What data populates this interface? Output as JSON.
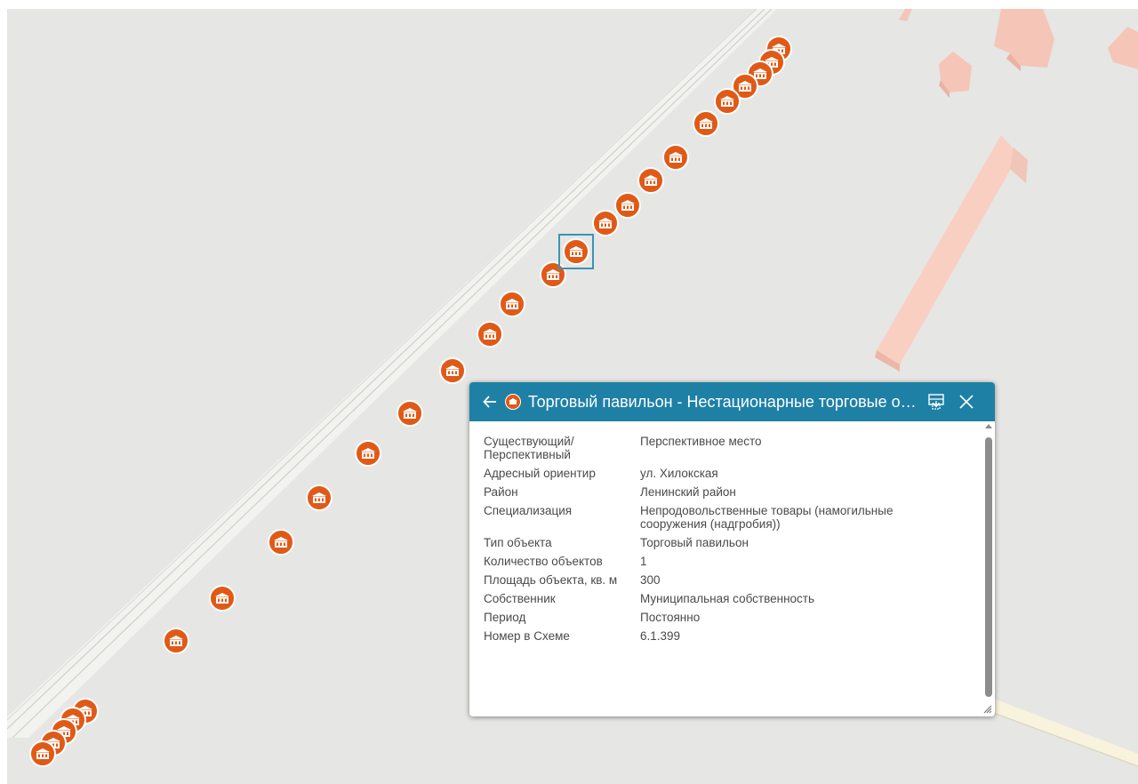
{
  "map": {
    "background": "#e6e6e4",
    "marker_color": "#e05a17",
    "marker_icon": "pavilion-icon",
    "selection_color": "#3b93b8",
    "building_color": "#f5c6b8"
  },
  "popup": {
    "title": "Торговый павильон - Нестационарные торговые объекты",
    "header_color": "#1f80a6",
    "back_icon": "arrow-left-icon",
    "dock_icon": "dock-icon",
    "close_icon": "close-icon",
    "rows": [
      {
        "key": "Существующий/ Перспективный",
        "value": "Перспективное место"
      },
      {
        "key": "Адресный ориентир",
        "value": "ул. Хилокская"
      },
      {
        "key": "Район",
        "value": "Ленинский район"
      },
      {
        "key": "Специализация",
        "value": "Непродовольственные товары (намогильные сооружения (надгробия))"
      },
      {
        "key": "Тип объекта",
        "value": "Торговый павильон"
      },
      {
        "key": "Количество объектов",
        "value": "1"
      },
      {
        "key": "Площадь объекта, кв. м",
        "value": "300"
      },
      {
        "key": "Собственник",
        "value": "Муниципальная собственность"
      },
      {
        "key": "Период",
        "value": "Постоянно"
      },
      {
        "key": "Номер в Схеме",
        "value": "6.1.399"
      }
    ]
  }
}
